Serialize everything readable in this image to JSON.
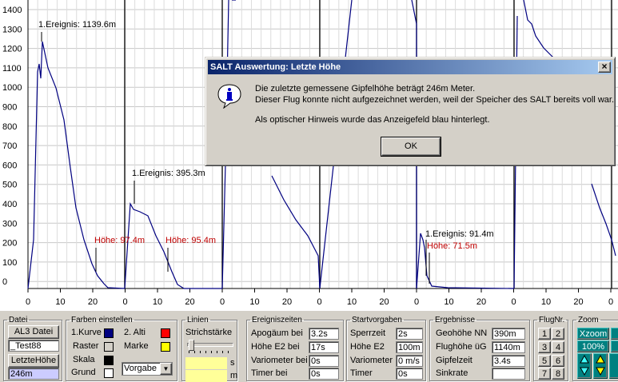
{
  "chart": {
    "y_ticks": [
      "1400",
      "1300",
      "1200",
      "1100",
      "1000",
      "900",
      "800",
      "700",
      "600",
      "500",
      "400",
      "300",
      "200",
      "100",
      "0"
    ],
    "x_ticks": [
      "0",
      "10",
      "20",
      "0",
      "10",
      "20",
      "0",
      "10",
      "20",
      "0",
      "10",
      "20",
      "0",
      "10",
      "20",
      "0",
      "10",
      "20",
      "0"
    ],
    "annotations": [
      {
        "text": "1.Ereignis: 1139.6m",
        "color": "#000000"
      },
      {
        "text": "1.Ereignis: 395.3m",
        "color": "#000000"
      },
      {
        "text": "1.Ereignis: 91.4m",
        "color": "#000000"
      },
      {
        "text": "Höhe: 97.4m",
        "color": "#c00000"
      },
      {
        "text": "Höhe: 95.4m",
        "color": "#c00000"
      },
      {
        "text": "Höhe: 71.5m",
        "color": "#c00000"
      }
    ],
    "curve_color": "#000080"
  },
  "dialog": {
    "title": "SALT Auswertung: Letzte Höhe",
    "close": "×",
    "line1": "Die zuletzte gemessene Gipfelhöhe beträgt  246m Meter.",
    "line2": "Dieser Flug konnte nicht aufgezeichnet werden, weil der Speicher des SALT bereits voll war.",
    "line3": "Als optischer Hinweis wurde das Anzeigefeld blau hinterlegt.",
    "ok": "OK"
  },
  "datei": {
    "legend": "Datei",
    "al3_button": "AL3 Datei",
    "file_name": "_Test88",
    "letzte_button": "LetzteHöhe",
    "letzte_value": "246m"
  },
  "farben": {
    "legend": "Farben einstellen",
    "kurve1": "1.Kurve",
    "alti2": "2. Alti",
    "raster": "Raster",
    "marke": "Marke",
    "skala": "Skala",
    "grund": "Grund",
    "vorgabe": "Vorgabe",
    "colors": {
      "kurve1": "#000080",
      "alti2": "#ff0000",
      "raster": "#d4d0c8",
      "marke": "#ffff00",
      "skala": "#000000",
      "grund": "#ffffff"
    }
  },
  "linien": {
    "legend": "Linien",
    "strichstaerke": "Strichstärke",
    "unit_s": "s",
    "unit_m": "m"
  },
  "ereignis": {
    "legend": "Ereigniszeiten",
    "rows": [
      {
        "label": "Apogäum bei",
        "value": "3.2s"
      },
      {
        "label": "Höhe E2 bei",
        "value": "17s"
      },
      {
        "label": "Variometer bei",
        "value": "0s"
      },
      {
        "label": "Timer bei",
        "value": "0s"
      }
    ]
  },
  "start": {
    "legend": "Startvorgaben",
    "rows": [
      {
        "label": "Sperrzeit",
        "value": "2s"
      },
      {
        "label": "Höhe E2",
        "value": "100m"
      },
      {
        "label": "Variometer",
        "value": "0 m/s"
      },
      {
        "label": "Timer",
        "value": "0s"
      }
    ]
  },
  "ergebnisse": {
    "legend": "Ergebnisse",
    "rows": [
      {
        "label": "Geohöhe NN",
        "value": "390m"
      },
      {
        "label": "Flughöhe üG",
        "value": "1140m"
      },
      {
        "label": "Gipfelzeit",
        "value": "3.4s"
      },
      {
        "label": "Sinkrate",
        "value": ""
      }
    ]
  },
  "flugnr": {
    "legend": "FlugNr.",
    "buttons": [
      "1",
      "2",
      "3",
      "4",
      "5",
      "6",
      "7",
      "8"
    ]
  },
  "zoom": {
    "legend": "Zoom",
    "xzoom": "Xzoom",
    "percent": "100%"
  }
}
